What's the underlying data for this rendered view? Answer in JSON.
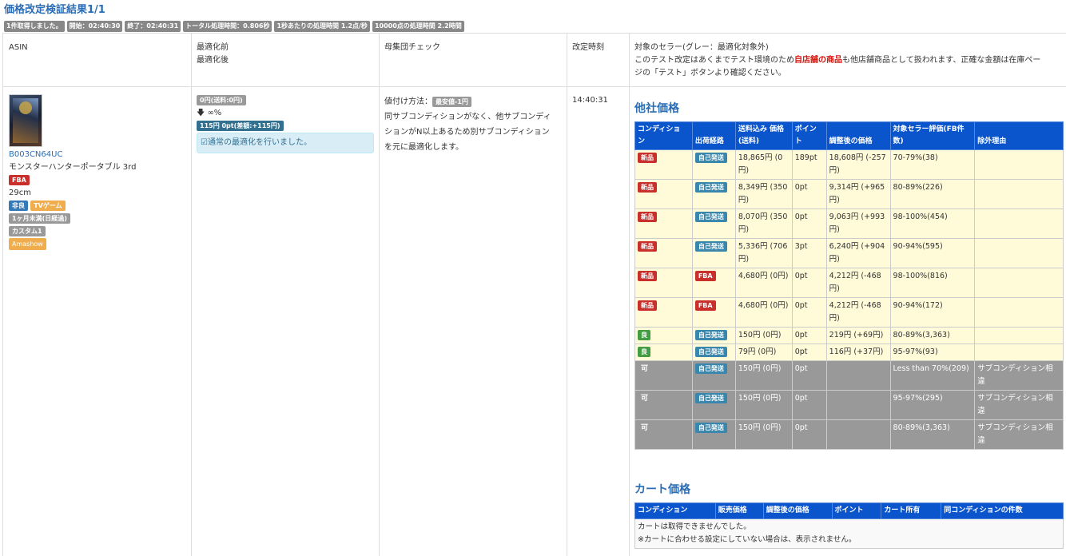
{
  "page": {
    "title": "価格改定検証結果1/1"
  },
  "status_badges": [
    "1件取得しました。",
    "開始：02:40:30",
    "終了：02:40:31",
    "トータル処理時間：0.806秒",
    "1秒あたりの処理時間 1.2点/秒",
    "10000点の処理時間 2.2時間"
  ],
  "headers": {
    "asin": "ASIN",
    "before": "最適化前",
    "after": "最適化後",
    "population": "母集団チェック",
    "revised_time": "改定時刻",
    "sellers_line1": "対象のセラー(グレー：最適化対象外)",
    "sellers_line2_pre": "このテスト改定はあくまでテスト環境のため",
    "sellers_line2_red": "自店舗の商品",
    "sellers_line2_post": "も他店舗商品として扱われます、正確な金額は在庫ペー",
    "sellers_line3": "ジの「テスト」ボタンより確認ください。"
  },
  "item": {
    "asin": "B003CN64UC",
    "name": "モンスターハンターポータブル 3rd",
    "fba_label": "FBA",
    "size": "29cm",
    "tag_bad": "非良",
    "tag_genre": "TVゲーム",
    "tag_period": "1ヶ月未満(日経過)",
    "tag_custom": "カスタム1",
    "tag_amashow": "Amashow",
    "price_before": "0円(送料:0円)",
    "change": "∞%",
    "price_after": "115円 0pt(差額:+115円)",
    "optimize_msg": "通常の最適化を行いました。",
    "method_label": "値付け方法：",
    "method_value": "最安値-1円",
    "population_text_1": "同サブコンディションがなく、他サブコンディ",
    "population_text_2": "ションがN以上あるため別サブコンディション",
    "population_text_3": "を元に最適化します。",
    "revised_time": "14:40:31"
  },
  "others": {
    "title": "他社価格",
    "columns": [
      "コンディショ ン",
      "出荷経路",
      "送料込み 価格(送料)",
      "ポイン ト",
      "調整後の価格",
      "対象セラー評価(FB件 数)",
      "除外理由"
    ],
    "rows": [
      {
        "cond": "新品",
        "cond_color": "red",
        "route": "自己発送",
        "route_color": "teal",
        "price": "18,865円 (0 円)",
        "pt": "189pt",
        "adj": "18,608円 (-257 円)",
        "rating": "70-79%(38)",
        "reason": "",
        "style": "yellow"
      },
      {
        "cond": "新品",
        "cond_color": "red",
        "route": "自己発送",
        "route_color": "teal",
        "price": "8,349円 (350 円)",
        "pt": "0pt",
        "adj": "9,314円 (+965 円)",
        "rating": "80-89%(226)",
        "reason": "",
        "style": "yellow"
      },
      {
        "cond": "新品",
        "cond_color": "red",
        "route": "自己発送",
        "route_color": "teal",
        "price": "8,070円 (350 円)",
        "pt": "0pt",
        "adj": "9,063円 (+993 円)",
        "rating": "98-100%(454)",
        "reason": "",
        "style": "yellow"
      },
      {
        "cond": "新品",
        "cond_color": "red",
        "route": "自己発送",
        "route_color": "teal",
        "price": "5,336円 (706 円)",
        "pt": "3pt",
        "adj": "6,240円 (+904 円)",
        "rating": "90-94%(595)",
        "reason": "",
        "style": "yellow"
      },
      {
        "cond": "新品",
        "cond_color": "red",
        "route": "FBA",
        "route_color": "red",
        "price": "4,680円 (0円)",
        "pt": "0pt",
        "adj": "4,212円 (-468 円)",
        "rating": "98-100%(816)",
        "reason": "",
        "style": "yellow"
      },
      {
        "cond": "新品",
        "cond_color": "red",
        "route": "FBA",
        "route_color": "red",
        "price": "4,680円 (0円)",
        "pt": "0pt",
        "adj": "4,212円 (-468 円)",
        "rating": "90-94%(172)",
        "reason": "",
        "style": "yellow"
      },
      {
        "cond": "良",
        "cond_color": "green",
        "route": "自己発送",
        "route_color": "teal",
        "price": "150円 (0円)",
        "pt": "0pt",
        "adj": "219円 (+69円)",
        "rating": "80-89%(3,363)",
        "reason": "",
        "style": "yellow"
      },
      {
        "cond": "良",
        "cond_color": "green",
        "route": "自己発送",
        "route_color": "teal",
        "price": "79円 (0円)",
        "pt": "0pt",
        "adj": "116円 (+37円)",
        "rating": "95-97%(93)",
        "reason": "",
        "style": "yellow"
      },
      {
        "cond": "可",
        "cond_color": "grey",
        "route": "自己発送",
        "route_color": "teal",
        "price": "150円 (0円)",
        "pt": "0pt",
        "adj": "",
        "rating": "Less than 70%(209)",
        "reason": "サブコンディション相違",
        "style": "grey"
      },
      {
        "cond": "可",
        "cond_color": "grey",
        "route": "自己発送",
        "route_color": "teal",
        "price": "150円 (0円)",
        "pt": "0pt",
        "adj": "",
        "rating": "95-97%(295)",
        "reason": "サブコンディション相違",
        "style": "grey"
      },
      {
        "cond": "可",
        "cond_color": "grey",
        "route": "自己発送",
        "route_color": "teal",
        "price": "150円 (0円)",
        "pt": "0pt",
        "adj": "",
        "rating": "80-89%(3,363)",
        "reason": "サブコンディション相違",
        "style": "grey"
      }
    ]
  },
  "cart": {
    "title": "カート価格",
    "columns": [
      "コンディション",
      "販売価格",
      "調整後の価格",
      "ポイント",
      "カート所有",
      "同コンディションの件数"
    ],
    "msg1": "カートは取得できませんでした。",
    "msg2": "※カートに合わせる設定にしていない場合は、表示されません。"
  }
}
